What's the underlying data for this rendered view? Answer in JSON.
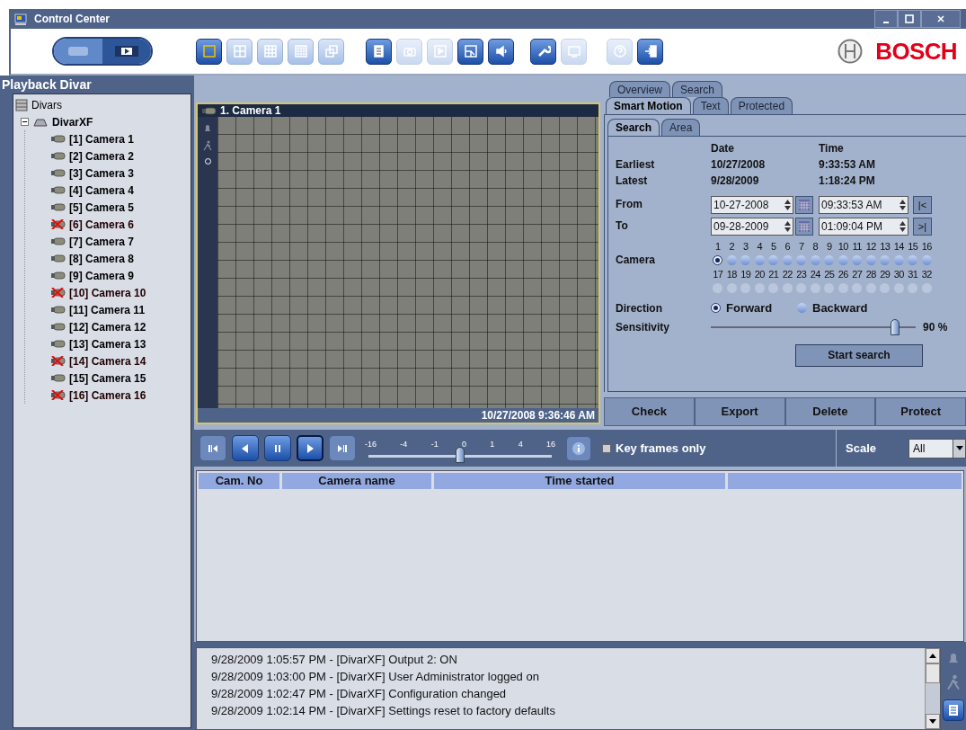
{
  "window": {
    "title": "Control Center"
  },
  "toolbar": {
    "mode_switch": [
      {
        "kind": "live",
        "selected": false
      },
      {
        "kind": "playback",
        "selected": true
      }
    ],
    "layouts": [
      {
        "kind": "single",
        "selected": true
      },
      {
        "kind": "quad",
        "selected": false
      },
      {
        "kind": "nine",
        "selected": false
      },
      {
        "kind": "sixteen",
        "selected": false
      },
      {
        "kind": "cascade",
        "selected": false
      }
    ],
    "actions": [
      {
        "kind": "document",
        "disabled": false
      },
      {
        "kind": "camera",
        "disabled": true
      },
      {
        "kind": "play",
        "disabled": true
      },
      {
        "kind": "export",
        "disabled": false
      },
      {
        "kind": "audio",
        "disabled": false
      }
    ],
    "tools": [
      {
        "kind": "wrench",
        "disabled": false
      },
      {
        "kind": "monitor",
        "disabled": true
      }
    ],
    "help": [
      {
        "kind": "help",
        "disabled": true
      },
      {
        "kind": "exit",
        "disabled": false
      }
    ],
    "brand": "BOSCH"
  },
  "sidebar": {
    "title": "Playback Divar",
    "tree": [
      {
        "label": "Divars",
        "kind": "root",
        "children": [
          {
            "label": "DivarXF",
            "kind": "recorder",
            "expanded": true,
            "children": [
              {
                "label": "[1] Camera 1",
                "kind": "camera",
                "offline": false
              },
              {
                "label": "[2] Camera 2",
                "kind": "camera",
                "offline": false
              },
              {
                "label": "[3] Camera 3",
                "kind": "camera",
                "offline": false
              },
              {
                "label": "[4] Camera 4",
                "kind": "camera",
                "offline": false
              },
              {
                "label": "[5] Camera 5",
                "kind": "camera",
                "offline": false
              },
              {
                "label": "[6] Camera 6",
                "kind": "camera",
                "offline": true
              },
              {
                "label": "[7] Camera 7",
                "kind": "camera",
                "offline": false
              },
              {
                "label": "[8] Camera 8",
                "kind": "camera",
                "offline": false
              },
              {
                "label": "[9] Camera 9",
                "kind": "camera",
                "offline": false
              },
              {
                "label": "[10] Camera 10",
                "kind": "camera",
                "offline": true
              },
              {
                "label": "[11] Camera 11",
                "kind": "camera",
                "offline": false
              },
              {
                "label": "[12] Camera 12",
                "kind": "camera",
                "offline": false
              },
              {
                "label": "[13] Camera 13",
                "kind": "camera",
                "offline": false
              },
              {
                "label": "[14] Camera 14",
                "kind": "camera",
                "offline": true
              },
              {
                "label": "[15] Camera 15",
                "kind": "camera",
                "offline": false
              },
              {
                "label": "[16] Camera 16",
                "kind": "camera",
                "offline": true
              }
            ]
          }
        ]
      }
    ]
  },
  "video": {
    "title": "1. Camera 1",
    "timestamp": "10/27/2008 9:36:46 AM"
  },
  "search_panel": {
    "tabs_top": [
      {
        "label": "Overview",
        "selected": false
      },
      {
        "label": "Search",
        "selected": false
      }
    ],
    "tabs": [
      {
        "label": "Smart Motion",
        "selected": true
      },
      {
        "label": "Text",
        "selected": false
      },
      {
        "label": "Protected",
        "selected": false
      }
    ],
    "subtabs": [
      {
        "label": "Search",
        "selected": true
      },
      {
        "label": "Area",
        "selected": false
      }
    ],
    "headers": [
      "Date",
      "Time"
    ],
    "ranges": [
      {
        "label": "Earliest",
        "date": "10/27/2008",
        "time": "9:33:53 AM"
      },
      {
        "label": "Latest",
        "date": "9/28/2009",
        "time": "1:18:24 PM"
      }
    ],
    "from": {
      "label": "From",
      "date": "10-27-2008",
      "time": "09:33:53 AM",
      "jump": "|<"
    },
    "to": {
      "label": "To",
      "date": "09-28-2009",
      "time": "01:09:04 PM",
      "jump": ">|"
    },
    "camera_label": "Camera",
    "cameras": [
      {
        "label": "1",
        "selected": true,
        "disabled": false
      },
      {
        "label": "2",
        "selected": false,
        "disabled": false
      },
      {
        "label": "3",
        "selected": false,
        "disabled": false
      },
      {
        "label": "4",
        "selected": false,
        "disabled": false
      },
      {
        "label": "5",
        "selected": false,
        "disabled": false
      },
      {
        "label": "6",
        "selected": false,
        "disabled": false
      },
      {
        "label": "7",
        "selected": false,
        "disabled": false
      },
      {
        "label": "8",
        "selected": false,
        "disabled": false
      },
      {
        "label": "9",
        "selected": false,
        "disabled": false
      },
      {
        "label": "10",
        "selected": false,
        "disabled": false
      },
      {
        "label": "11",
        "selected": false,
        "disabled": false
      },
      {
        "label": "12",
        "selected": false,
        "disabled": false
      },
      {
        "label": "13",
        "selected": false,
        "disabled": false
      },
      {
        "label": "14",
        "selected": false,
        "disabled": false
      },
      {
        "label": "15",
        "selected": false,
        "disabled": false
      },
      {
        "label": "16",
        "selected": false,
        "disabled": false
      },
      {
        "label": "17",
        "selected": false,
        "disabled": true
      },
      {
        "label": "18",
        "selected": false,
        "disabled": true
      },
      {
        "label": "19",
        "selected": false,
        "disabled": true
      },
      {
        "label": "20",
        "selected": false,
        "disabled": true
      },
      {
        "label": "21",
        "selected": false,
        "disabled": true
      },
      {
        "label": "22",
        "selected": false,
        "disabled": true
      },
      {
        "label": "23",
        "selected": false,
        "disabled": true
      },
      {
        "label": "24",
        "selected": false,
        "disabled": true
      },
      {
        "label": "25",
        "selected": false,
        "disabled": true
      },
      {
        "label": "26",
        "selected": false,
        "disabled": true
      },
      {
        "label": "27",
        "selected": false,
        "disabled": true
      },
      {
        "label": "28",
        "selected": false,
        "disabled": true
      },
      {
        "label": "29",
        "selected": false,
        "disabled": true
      },
      {
        "label": "30",
        "selected": false,
        "disabled": true
      },
      {
        "label": "31",
        "selected": false,
        "disabled": true
      },
      {
        "label": "32",
        "selected": false,
        "disabled": true
      }
    ],
    "direction": {
      "label": "Direction",
      "options": [
        {
          "label": "Forward",
          "selected": true
        },
        {
          "label": "Backward",
          "selected": false
        }
      ]
    },
    "sensitivity": {
      "label": "Sensitivity",
      "level": 0.9,
      "reading": "90 %"
    },
    "start_button": "Start search",
    "actions": [
      "Check",
      "Export",
      "Delete",
      "Protect"
    ]
  },
  "playback": {
    "speed_ticks": [
      "-16",
      "-4",
      "-1",
      "0",
      "1",
      "4",
      "16"
    ],
    "speed": {
      "level": 0.5
    },
    "key_frames": {
      "label": "Key frames only",
      "checked": false
    },
    "scale": {
      "label": "Scale",
      "value": "All"
    }
  },
  "table": {
    "columns": [
      "Cam. No",
      "Camera name",
      "Time started"
    ]
  },
  "log": [
    "9/28/2009 1:05:57 PM - [DivarXF] Output 2: ON",
    "9/28/2009 1:03:00 PM - [DivarXF] User Administrator logged on",
    "9/28/2009 1:02:47 PM - [DivarXF] Configuration changed",
    "9/28/2009 1:02:14 PM - [DivarXF] Settings reset to factory defaults"
  ]
}
